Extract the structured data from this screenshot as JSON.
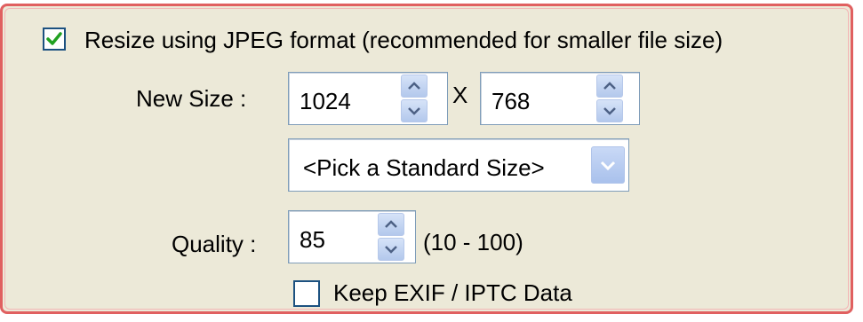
{
  "resize_checkbox": {
    "label": "Resize using JPEG format (recommended for smaller file size)",
    "checked": true
  },
  "new_size": {
    "label": "New Size :",
    "width": "1024",
    "separator": "X",
    "height": "768"
  },
  "standard_size": {
    "selected": "<Pick a Standard Size>"
  },
  "quality": {
    "label": "Quality :",
    "value": "85",
    "range": "(10 - 100)"
  },
  "exif_checkbox": {
    "label": "Keep EXIF / IPTC Data",
    "checked": false
  },
  "icons": {
    "check": "check-icon",
    "spin_up": "chevron-up-icon",
    "spin_down": "chevron-down-icon",
    "dropdown": "chevron-down-icon"
  },
  "colors": {
    "panel_background": "#ece9d8",
    "panel_border": "#e06060",
    "checkbox_border": "#1c5180",
    "check_mark": "#21a121",
    "textbox_border": "#7f9db9",
    "spinner_button": "#b3c8ec"
  }
}
